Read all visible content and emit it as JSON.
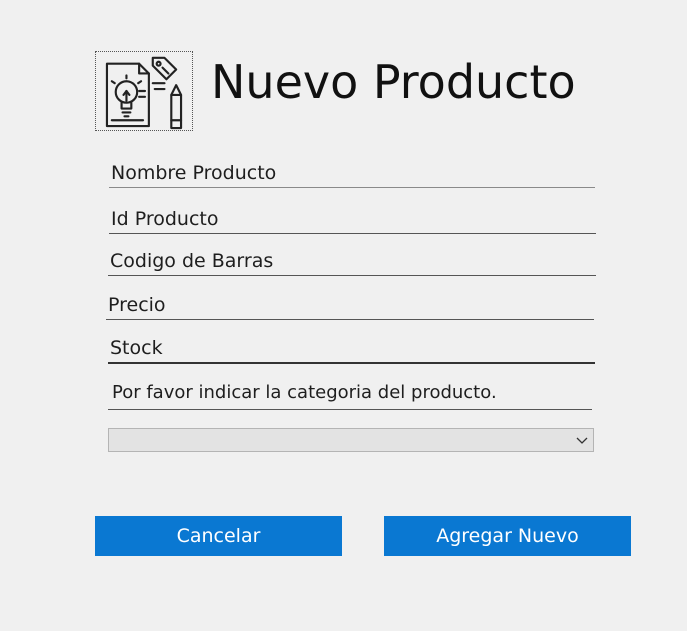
{
  "header": {
    "title": "Nuevo Producto",
    "logo_icon": "product-idea-icon"
  },
  "form": {
    "nombre_placeholder": "Nombre Producto",
    "id_placeholder": "Id Producto",
    "codigo_placeholder": "Codigo de Barras",
    "precio_placeholder": "Precio",
    "stock_placeholder": "Stock",
    "categoria_prompt": "Por favor indicar la categoria del producto.",
    "categoria_selected": ""
  },
  "buttons": {
    "cancel_label": "Cancelar",
    "add_label": "Agregar Nuevo"
  },
  "colors": {
    "accent": "#0a78d2",
    "background": "#f0f0f0"
  }
}
